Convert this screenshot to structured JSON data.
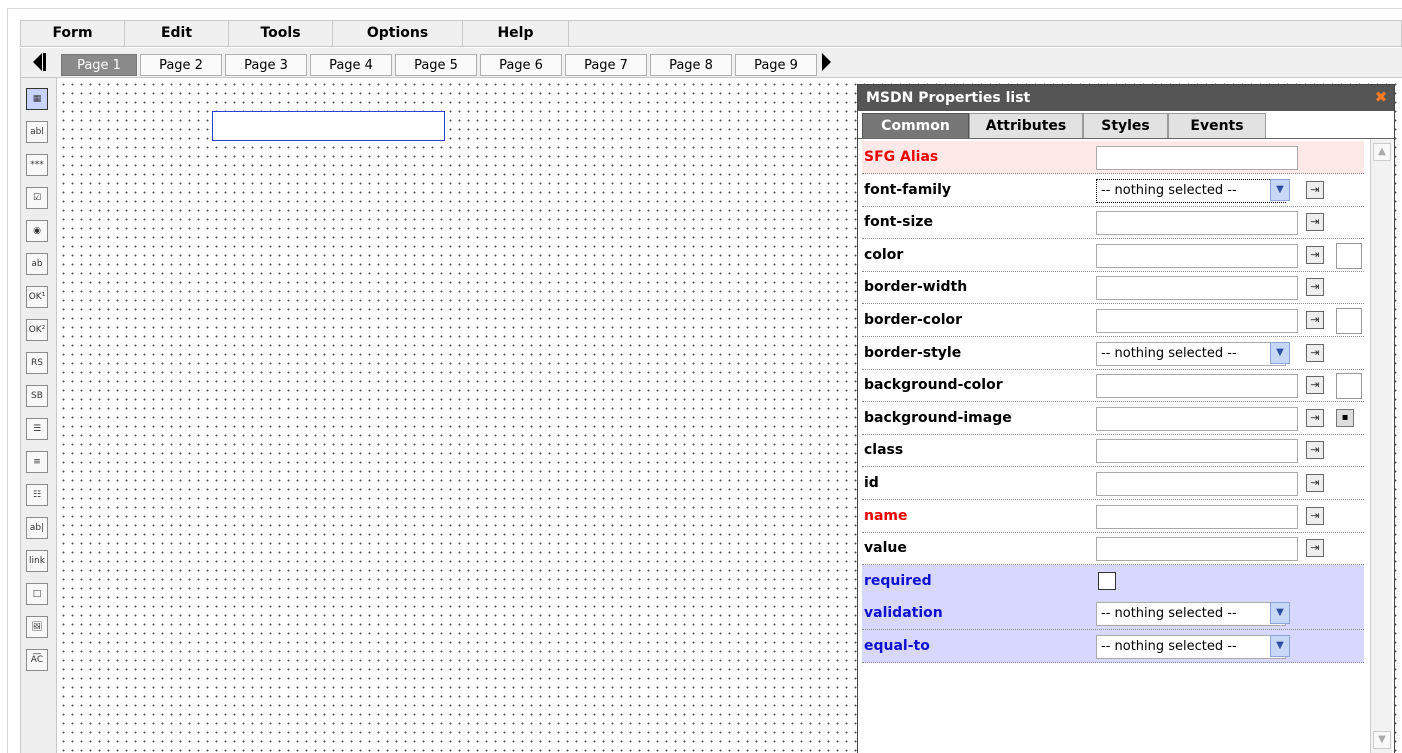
{
  "menu": {
    "items": [
      {
        "label": "Form"
      },
      {
        "label": "Edit"
      },
      {
        "label": "Tools"
      },
      {
        "label": "Options"
      },
      {
        "label": "Help"
      }
    ]
  },
  "pages": {
    "tabs": [
      {
        "label": "Page 1",
        "active": true
      },
      {
        "label": "Page 2"
      },
      {
        "label": "Page 3"
      },
      {
        "label": "Page 4"
      },
      {
        "label": "Page 5"
      },
      {
        "label": "Page 6"
      },
      {
        "label": "Page 7"
      },
      {
        "label": "Page 8"
      },
      {
        "label": "Page 9"
      }
    ]
  },
  "toolbox": {
    "tools": [
      {
        "name": "select-tool-icon",
        "glyph": "▦"
      },
      {
        "name": "textbox-tool-icon",
        "glyph": "abl"
      },
      {
        "name": "password-tool-icon",
        "glyph": "***"
      },
      {
        "name": "checkbox-tool-icon",
        "glyph": "☑"
      },
      {
        "name": "radio-tool-icon",
        "glyph": "◉"
      },
      {
        "name": "textarea-tool-icon",
        "glyph": "ab"
      },
      {
        "name": "button1-tool-icon",
        "glyph": "OK¹"
      },
      {
        "name": "button2-tool-icon",
        "glyph": "OK²"
      },
      {
        "name": "reset-button-tool-icon",
        "glyph": "RS"
      },
      {
        "name": "submit-button-tool-icon",
        "glyph": "SB"
      },
      {
        "name": "listbox-tool-icon",
        "glyph": "☰"
      },
      {
        "name": "select-list-tool-icon",
        "glyph": "≡"
      },
      {
        "name": "multiselect-tool-icon",
        "glyph": "☷"
      },
      {
        "name": "label-tool-icon",
        "glyph": "ab|"
      },
      {
        "name": "link-tool-icon",
        "glyph": "link"
      },
      {
        "name": "frame-tool-icon",
        "glyph": "□"
      },
      {
        "name": "image-tool-icon",
        "glyph": "🖼"
      },
      {
        "name": "spellcheck-tool-icon",
        "glyph": "A͞C"
      }
    ]
  },
  "panel": {
    "title": "MSDN Properties list",
    "close_icon": "✖",
    "tabs": [
      {
        "label": "Common",
        "active": true
      },
      {
        "label": "Attributes"
      },
      {
        "label": "Styles"
      },
      {
        "label": "Events"
      }
    ],
    "properties": [
      {
        "label": "SFG Alias",
        "kind": "input",
        "style": "alias",
        "value": ""
      },
      {
        "label": "font-family",
        "kind": "select",
        "value": "-- nothing selected --",
        "focus": true,
        "pick": true
      },
      {
        "label": "font-size",
        "kind": "input",
        "value": "",
        "pick": true
      },
      {
        "label": "color",
        "kind": "input",
        "value": "",
        "pick": true,
        "swatch": true
      },
      {
        "label": "border-width",
        "kind": "input",
        "value": "",
        "pick": true
      },
      {
        "label": "border-color",
        "kind": "input",
        "value": "",
        "pick": true,
        "swatch": true
      },
      {
        "label": "border-style",
        "kind": "select",
        "value": "-- nothing selected --",
        "pick": true
      },
      {
        "label": "background-color",
        "kind": "input",
        "value": "",
        "pick": true,
        "swatch": true
      },
      {
        "label": "background-image",
        "kind": "input",
        "value": "",
        "pick": true,
        "image": true
      },
      {
        "label": "class",
        "kind": "input",
        "value": "",
        "pick": true
      },
      {
        "label": "id",
        "kind": "input",
        "value": "",
        "pick": true
      },
      {
        "label": "name",
        "kind": "input",
        "value": "",
        "pick": true,
        "labelColor": "red"
      },
      {
        "label": "value",
        "kind": "input",
        "value": "",
        "pick": true
      },
      {
        "label": "required",
        "kind": "checkbox",
        "style": "req",
        "labelColor": "blue",
        "checked": false
      },
      {
        "label": "validation",
        "kind": "select",
        "style": "req",
        "labelColor": "blue",
        "value": "-- nothing selected --"
      },
      {
        "label": "equal-to",
        "kind": "select",
        "style": "req",
        "labelColor": "blue",
        "value": "-- nothing selected --"
      }
    ]
  },
  "colors": {
    "accent_blue": "#2a3fd6",
    "required_row": "#d8d8ff",
    "alias_row": "#ffe8e8",
    "close_orange": "#ff7a20"
  }
}
